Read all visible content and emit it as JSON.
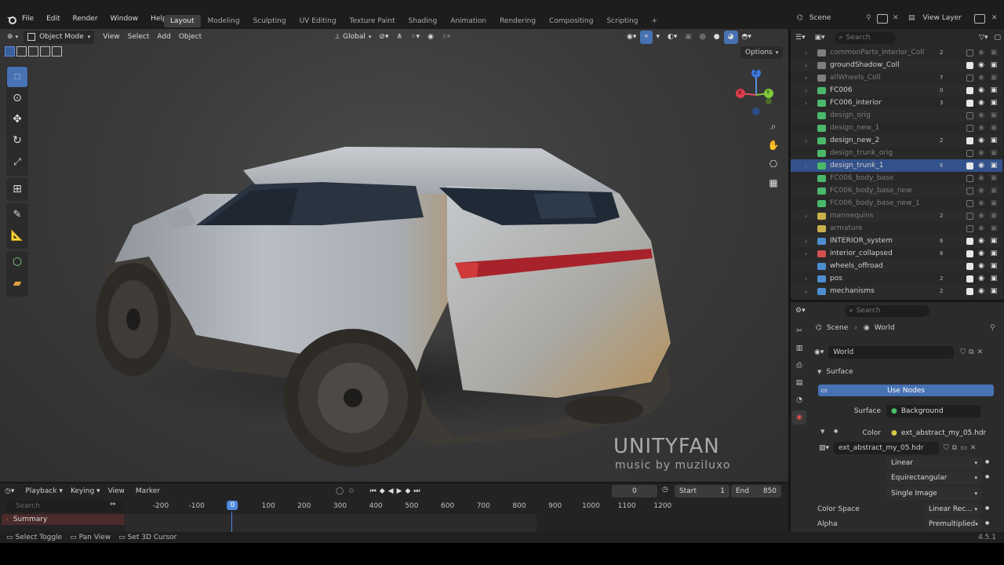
{
  "topbar": {
    "menus": [
      "File",
      "Edit",
      "Render",
      "Window",
      "Help"
    ],
    "workspaces": [
      "Layout",
      "Modeling",
      "Sculpting",
      "UV Editing",
      "Texture Paint",
      "Shading",
      "Animation",
      "Rendering",
      "Compositing",
      "Scripting"
    ],
    "active_workspace": "Layout",
    "add_tab": "+",
    "scene_label": "Scene",
    "view_layer_label": "View Layer"
  },
  "viewport_header": {
    "mode": "Object Mode",
    "menus": [
      "View",
      "Select",
      "Add",
      "Object"
    ],
    "transform_orientation": "Global",
    "options": "Options"
  },
  "gizmo": {
    "z": "Z",
    "y": "Y",
    "x": "X"
  },
  "watermark": {
    "title": "UNITYFAN",
    "subtitle": "music by muziluxo"
  },
  "outliner": {
    "search_placeholder": "Search",
    "rows": [
      {
        "name": "commonParts_Interior_Coll",
        "dim": true,
        "arrow": true,
        "color": "#7f7f7f",
        "badge": "2",
        "checked": false
      },
      {
        "name": "groundShadow_Coll",
        "dim": false,
        "arrow": true,
        "color": "#7f7f7f",
        "badge": "",
        "checked": true
      },
      {
        "name": "allWheels_Coll",
        "dim": true,
        "arrow": true,
        "color": "#7f7f7f",
        "badge": "7",
        "checked": false
      },
      {
        "name": "FC006",
        "dim": false,
        "arrow": true,
        "color": "#4bb86a",
        "badge": "0",
        "checked": true
      },
      {
        "name": "FC006_interior",
        "dim": false,
        "arrow": true,
        "color": "#4bb86a",
        "badge": "3",
        "checked": true
      },
      {
        "name": "design_orig",
        "dim": true,
        "arrow": false,
        "color": "#4bb86a",
        "badge": "",
        "checked": false
      },
      {
        "name": "design_new_1",
        "dim": true,
        "arrow": false,
        "color": "#4bb86a",
        "badge": "",
        "checked": false
      },
      {
        "name": "design_new_2",
        "dim": false,
        "arrow": true,
        "color": "#4bb86a",
        "badge": "2",
        "checked": true
      },
      {
        "name": "design_trunk_orig",
        "dim": true,
        "arrow": false,
        "color": "#4bb86a",
        "badge": "",
        "checked": false
      },
      {
        "name": "design_trunk_1",
        "dim": false,
        "arrow": true,
        "color": "#4bb86a",
        "badge": "6",
        "checked": true,
        "selected": true
      },
      {
        "name": "FC006_body_base",
        "dim": true,
        "arrow": false,
        "color": "#4bb86a",
        "badge": "",
        "checked": false
      },
      {
        "name": "FC006_body_base_new",
        "dim": true,
        "arrow": false,
        "color": "#4bb86a",
        "badge": "",
        "checked": false
      },
      {
        "name": "FC006_body_base_new_1",
        "dim": true,
        "arrow": false,
        "color": "#4bb86a",
        "badge": "",
        "checked": false
      },
      {
        "name": "mannequins",
        "dim": true,
        "arrow": true,
        "color": "#c8b04a",
        "badge": "2",
        "checked": false
      },
      {
        "name": "armature",
        "dim": true,
        "arrow": false,
        "color": "#c8b04a",
        "badge": "",
        "checked": false
      },
      {
        "name": "INTERIOR_system",
        "dim": false,
        "arrow": true,
        "color": "#4e8ed0",
        "badge": "6",
        "checked": true
      },
      {
        "name": "interior_collapsed",
        "dim": false,
        "arrow": true,
        "color": "#d05050",
        "badge": "8",
        "checked": true
      },
      {
        "name": "wheels_offroad",
        "dim": false,
        "arrow": false,
        "color": "#4e8ed0",
        "badge": "",
        "checked": true
      },
      {
        "name": "pos",
        "dim": false,
        "arrow": true,
        "color": "#4e8ed0",
        "badge": "2",
        "checked": true
      },
      {
        "name": "mechanisms",
        "dim": false,
        "arrow": true,
        "color": "#4e8ed0",
        "badge": "2",
        "checked": true
      }
    ]
  },
  "properties": {
    "search_placeholder": "Search",
    "breadcrumb": [
      "Scene",
      "World"
    ],
    "world_name": "World",
    "panel": "Surface",
    "use_nodes": "Use Nodes",
    "surface_label": "Surface",
    "surface_value": "Background",
    "color_label": "Color",
    "color_value": "ext_abstract_my_05.hdr",
    "image_name": "ext_abstract_my_05.hdr",
    "interpolation": "Linear",
    "projection": "Equirectangular",
    "source": "Single Image",
    "color_space_label": "Color Space",
    "color_space_value": "Linear Rec...",
    "alpha_label": "Alpha",
    "alpha_value": "Premultiplied"
  },
  "timeline": {
    "menus": [
      "Playback",
      "Keying",
      "View",
      "Marker"
    ],
    "current_frame": "0",
    "start_label": "Start",
    "start_value": "1",
    "end_label": "End",
    "end_value": "850",
    "search_placeholder": "Search",
    "summary": "Summary",
    "ticks": [
      "-200",
      "-100",
      "0",
      "100",
      "200",
      "300",
      "400",
      "500",
      "600",
      "700",
      "800",
      "900",
      "1000",
      "1100",
      "1200"
    ]
  },
  "status": {
    "items": [
      "Select Toggle",
      "Pan View",
      "Set 3D Cursor"
    ],
    "version": "4.5.1"
  }
}
